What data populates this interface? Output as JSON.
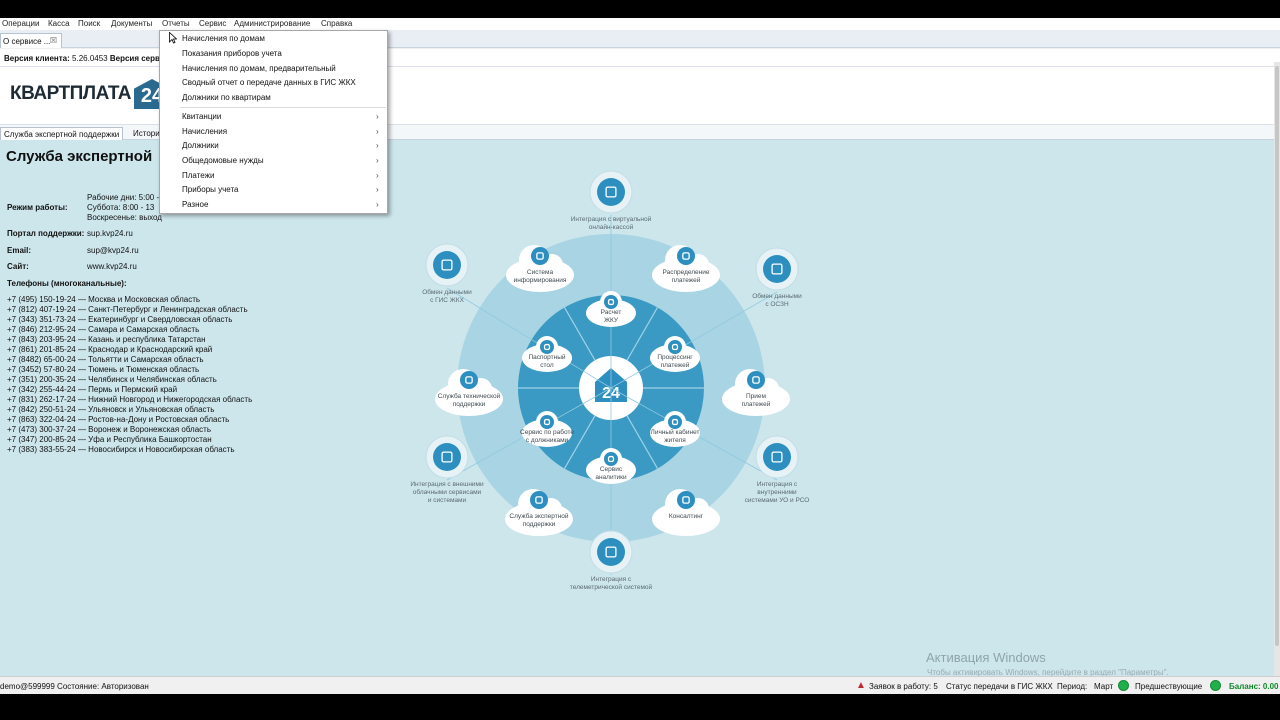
{
  "menu": [
    "Операции",
    "Касса",
    "Поиск",
    "Документы",
    "Отчеты",
    "Сервис",
    "Администрирование",
    "Справка"
  ],
  "tab": {
    "label": "О сервисе ...",
    "close": "☒"
  },
  "version": {
    "client_label": "Версия клиента:",
    "client_value": "5.26.0453",
    "server_label": "Версия серве"
  },
  "logo": {
    "text": "КВАРТПЛАТА",
    "badge": "24"
  },
  "subtabs": [
    "Служба экспертной поддержки",
    "Истори"
  ],
  "support": {
    "title": "Служба экспертной",
    "hours_label": "Режим работы:",
    "hours_lines": [
      "Рабочие дни: 5:00 -",
      "Суббота:     8:00 - 13",
      "Воскресенье: выход"
    ],
    "portal_label": "Портал поддержки:",
    "portal_value": "sup.kvp24.ru",
    "email_label": "Email:",
    "email_value": "sup@kvp24.ru",
    "site_label": "Сайт:",
    "site_value": "www.kvp24.ru",
    "phones_label": "Телефоны (многоканальные):",
    "phones": [
      "+7 (495) 150-19-24 — Москва и Московская область",
      "+7 (812) 407-19-24 — Санкт-Петербург и Ленинградская область",
      "+7 (343) 351-73-24 — Екатеринбург и Свердловская область",
      "+7 (846) 212-95-24 — Самара и Самарская область",
      "+7 (843) 203-95-24 — Казань и республика Татарстан",
      "+7 (861) 201-85-24 — Краснодар и Краснодарский край",
      "+7 (8482) 65-00-24 — Тольятти и Самарская область",
      "+7 (3452) 57-80-24 — Тюмень и Тюменская область",
      "+7 (351) 200-35-24 — Челябинск и Челябинская область",
      "+7 (342) 255-44-24 — Пермь и Пермский край",
      "+7 (831) 262-17-24 — Нижний Новгород и Нижегородская область",
      "+7 (842) 250-51-24 — Ульяновск и Ульяновская область",
      "+7 (863) 322-04-24 — Ростов-на-Дону и Ростовская область",
      "+7 (473) 300-37-24 — Воронеж и Воронежская область",
      "+7 (347) 200-85-24 — Уфа и Республика Башкортостан",
      "+7 (383) 383-55-24 — Новосибирск и Новосибирская область"
    ]
  },
  "diagram": {
    "center": "24",
    "inner": [
      {
        "name": "raschet-zhku",
        "icon": "document-icon",
        "lines": [
          "Расчет",
          "ЖКУ"
        ]
      },
      {
        "name": "processing-platezhey",
        "icon": "gears-icon",
        "lines": [
          "Процессинг",
          "платежей"
        ]
      },
      {
        "name": "lichny-kabinet",
        "icon": "house-icon",
        "lines": [
          "Личный кабинет",
          "жителя"
        ]
      },
      {
        "name": "servis-analitiki",
        "icon": "chart-icon",
        "lines": [
          "Сервис",
          "аналитики"
        ]
      },
      {
        "name": "servis-dolzhniki",
        "icon": "person-icon",
        "lines": [
          "Сервис по работе",
          "с должниками"
        ]
      },
      {
        "name": "pasportny-stol",
        "icon": "passport-icon",
        "lines": [
          "Паспортный",
          "стол"
        ]
      }
    ],
    "middle": [
      {
        "name": "sistema-informirovaniya",
        "icon": "megaphone-icon",
        "lines": [
          "Система",
          "информирования"
        ]
      },
      {
        "name": "raspredelenie-platezhey",
        "icon": "distribution-icon",
        "lines": [
          "Распределение",
          "платежей"
        ]
      },
      {
        "name": "priem-platezhey",
        "icon": "wallet-icon",
        "lines": [
          "Прием",
          "платежей"
        ]
      },
      {
        "name": "konsalting",
        "icon": "consultant-icon",
        "lines": [
          "Консалтинг"
        ]
      },
      {
        "name": "sluzhba-ekspertnoy",
        "icon": "group-icon",
        "lines": [
          "Служба экспертной",
          "поддержки"
        ]
      },
      {
        "name": "sluzhba-tehnicheskoy",
        "icon": "headset-icon",
        "lines": [
          "Служба технической",
          "поддержки"
        ]
      }
    ],
    "outer": [
      {
        "name": "integraciya-kassa",
        "icon": "cloud-register-icon",
        "lines": [
          "Интеграция с виртуальной",
          "онлайн-кассой"
        ]
      },
      {
        "name": "obmen-oszn",
        "icon": "fingerprint-icon",
        "lines": [
          "Обмен данными",
          "с ОСЗН"
        ]
      },
      {
        "name": "integraciya-uo-rso",
        "icon": "network-icon",
        "lines": [
          "Интеграция с",
          "внутренними",
          "системами УО и РСО"
        ]
      },
      {
        "name": "integraciya-telemetry",
        "icon": "database-icon",
        "lines": [
          "Интеграция с",
          "телеметрической системой"
        ]
      },
      {
        "name": "integraciya-oblachnye",
        "icon": "cloud-network-icon",
        "lines": [
          "Интеграция с внешними",
          "облачными сервисами",
          "и системами"
        ]
      },
      {
        "name": "obmen-gis-zhkh",
        "icon": "building-icon",
        "lines": [
          "Обмен данными",
          "с ГИС ЖКХ"
        ]
      }
    ]
  },
  "watermark": {
    "title": "Активация Windows",
    "text": "Чтобы активировать Windows, перейдите в раздел \"Параметры\"."
  },
  "status": {
    "user": "demo@599999 Состояние: Авторизован",
    "requests": "Заявок в работу: 5",
    "gis": "Статус передачи в ГИС ЖКХ",
    "period_label": "Период:",
    "period_value": "Март",
    "previous": "Предшествующие",
    "balance": "Баланс: 0.00"
  },
  "dropdown": {
    "items": [
      "Начисления по домам",
      "Показания приборов учета",
      "Начисления по домам, предварительный",
      "Сводный отчет о передаче данных в ГИС ЖКХ",
      "Должники по квартирам"
    ],
    "submenus": [
      "Квитанции",
      "Начисления",
      "Должники",
      "Общедомовые нужды",
      "Платежи",
      "Приборы учета",
      "Разное"
    ]
  },
  "colors": {
    "main_bg": "#cde6ec",
    "ring_light": "#a8d4e4",
    "ring_mid": "#5fb3d3",
    "ring_dark": "#3a9ac4",
    "icon_blue": "#2d8fc0",
    "status_green": "#1fb04a"
  }
}
